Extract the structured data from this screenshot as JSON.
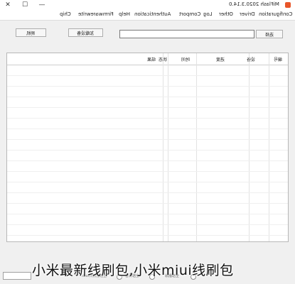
{
  "window": {
    "title": "MiFlash 2020.3.14.0",
    "controls": {
      "close": "✕",
      "maximize": "☐",
      "minimize": "—"
    }
  },
  "menu": {
    "items": [
      "Configuration",
      "Driver",
      "Other",
      "Log",
      "Comport",
      "Authentication",
      "Help",
      "Firmwarewrite",
      "Chip"
    ]
  },
  "toolbar": {
    "select_label": "选择",
    "load_device_label": "加载设备",
    "flash_label": "刷机",
    "path_value": ""
  },
  "table": {
    "columns": [
      "编号",
      "设备",
      "进度",
      "时间",
      "状态",
      "结果"
    ]
  },
  "bottom": {
    "options": [
      "全部删除",
      "全部保留",
      "全部删除并lock"
    ]
  },
  "caption": {
    "text": "小米最新线刷包,小米miui线刷包"
  },
  "colors": {
    "app_icon": "#e8562a",
    "window_bg": "#f0f0f0"
  }
}
